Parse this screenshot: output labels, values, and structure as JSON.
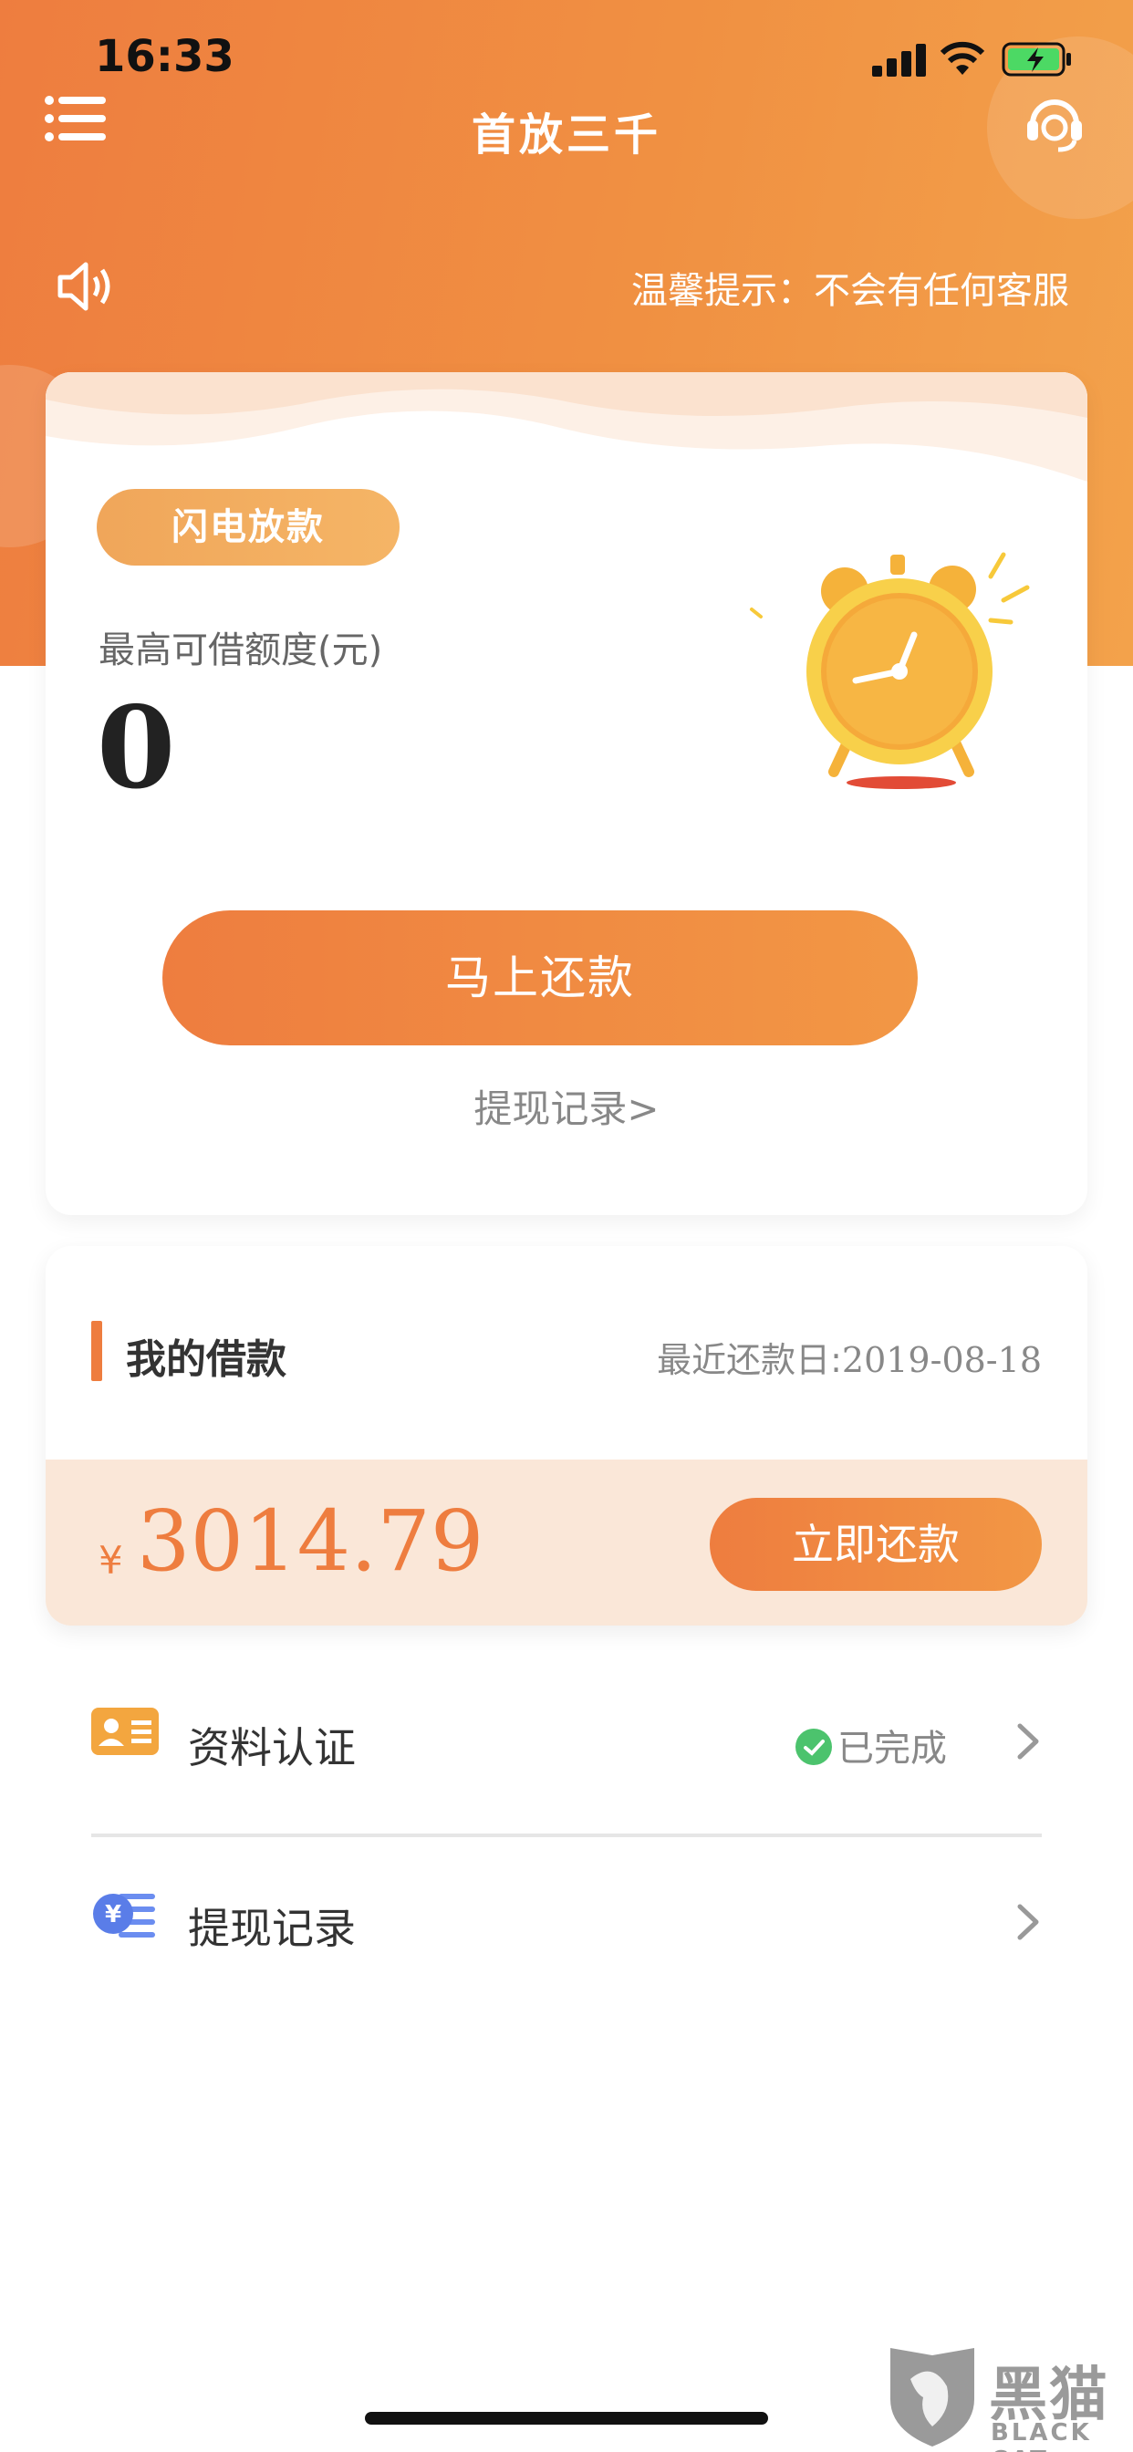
{
  "status_bar": {
    "time": "16:33"
  },
  "nav": {
    "title": "首放三千"
  },
  "notice": {
    "text": "温馨提示：不会有任何客服"
  },
  "main_card": {
    "badge": "闪电放款",
    "limit_label": "最高可借额度(元)",
    "limit_value": "0",
    "repay_button": "马上还款",
    "record_link": "提现记录>"
  },
  "loan_card": {
    "title": "我的借款",
    "recent_label": "最近还款日:",
    "recent_date": "2019-08-18",
    "currency": "¥",
    "amount": "3014.79",
    "pay_button": "立即还款"
  },
  "list": [
    {
      "label": "资料认证",
      "status": "已完成",
      "icon": "id-card-icon"
    },
    {
      "label": "提现记录",
      "status": "",
      "icon": "yuan-coin-icon"
    }
  ],
  "watermark": {
    "cn": "黑猫",
    "en": "BLACK CAT"
  },
  "colors": {
    "accent": "#ee7d3f",
    "accent_light": "#f29745",
    "footer_bg": "#fae7d8",
    "success": "#4cc36d"
  }
}
